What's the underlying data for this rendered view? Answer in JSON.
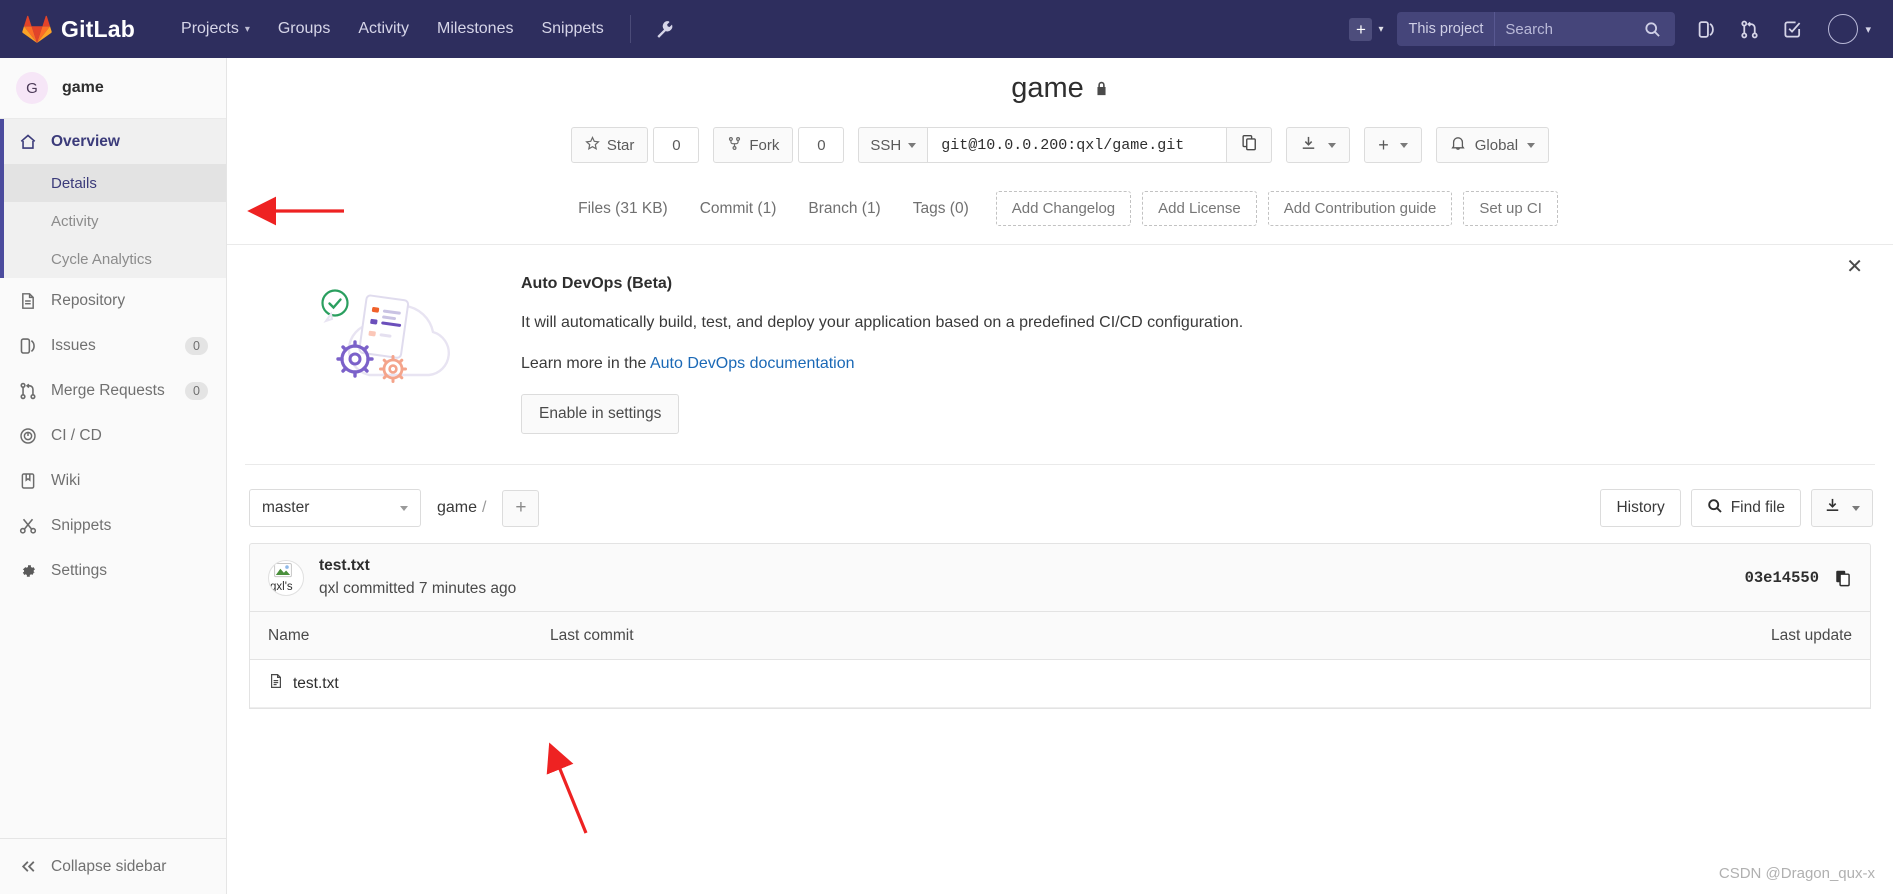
{
  "navbar": {
    "brand": "GitLab",
    "links": [
      {
        "label": "Projects",
        "has_caret": true
      },
      {
        "label": "Groups",
        "has_caret": false
      },
      {
        "label": "Activity",
        "has_caret": false
      },
      {
        "label": "Milestones",
        "has_caret": false
      },
      {
        "label": "Snippets",
        "has_caret": false
      }
    ],
    "wrench_icon": "wrench-icon",
    "plus_icon": "plus-icon",
    "search": {
      "scope": "This project",
      "value": "",
      "placeholder": "Search"
    },
    "icons": [
      {
        "name": "issues-icon"
      },
      {
        "name": "merge-requests-icon"
      },
      {
        "name": "todos-icon"
      }
    ],
    "avatar_icon": "user-avatar-icon"
  },
  "sidebar": {
    "project_initial": "G",
    "project_name": "game",
    "overview": {
      "label": "Overview",
      "icon": "home-icon",
      "subitems": [
        {
          "label": "Details",
          "selected": true
        },
        {
          "label": "Activity",
          "selected": false
        },
        {
          "label": "Cycle Analytics",
          "selected": false
        }
      ]
    },
    "items": [
      {
        "label": "Repository",
        "icon": "document-icon",
        "badge": ""
      },
      {
        "label": "Issues",
        "icon": "issues-icon",
        "badge": "0"
      },
      {
        "label": "Merge Requests",
        "icon": "merge-requests-icon",
        "badge": "0"
      },
      {
        "label": "CI / CD",
        "icon": "rocket-icon",
        "badge": ""
      },
      {
        "label": "Wiki",
        "icon": "book-icon",
        "badge": ""
      },
      {
        "label": "Snippets",
        "icon": "scissors-icon",
        "badge": ""
      },
      {
        "label": "Settings",
        "icon": "gear-icon",
        "badge": ""
      }
    ],
    "collapse": {
      "label": "Collapse sidebar",
      "icon": "double-chevron-left-icon"
    }
  },
  "project": {
    "title": "game",
    "visibility_icon": "lock-icon",
    "star": {
      "label": "Star",
      "count": "0",
      "icon": "star-icon"
    },
    "fork": {
      "label": "Fork",
      "count": "0",
      "icon": "fork-icon"
    },
    "clone": {
      "protocol": "SSH",
      "url": "git@10.0.0.200:qxl/game.git",
      "copy_icon": "copy-icon"
    },
    "download_icon": "download-icon",
    "add_icon": "plus-icon",
    "notification": {
      "label": "Global",
      "icon": "bell-icon"
    }
  },
  "stats": {
    "links": [
      {
        "label": "Files (31 KB)"
      },
      {
        "label": "Commit (1)"
      },
      {
        "label": "Branch (1)"
      },
      {
        "label": "Tags (0)"
      }
    ],
    "actions": [
      {
        "label": "Add Changelog"
      },
      {
        "label": "Add License"
      },
      {
        "label": "Add Contribution guide"
      },
      {
        "label": "Set up CI"
      }
    ]
  },
  "auto_devops": {
    "title": "Auto DevOps (Beta)",
    "description": "It will automatically build, test, and deploy your application based on a predefined CI/CD configuration.",
    "learn_prefix": "Learn more in the ",
    "learn_link": "Auto DevOps documentation",
    "enable_label": "Enable in settings",
    "close_icon": "close-icon"
  },
  "tree": {
    "branch": "master",
    "breadcrumb_root": "game",
    "breadcrumb_sep": "/",
    "add_icon": "plus-icon",
    "history_label": "History",
    "find_file_label": "Find file",
    "find_file_icon": "search-icon",
    "download_icon": "download-icon"
  },
  "last_commit": {
    "avatar_alt": "qxl's",
    "title": "test.txt",
    "meta": "qxl committed 7 minutes ago",
    "sha": "03e14550",
    "copy_icon": "copy-icon"
  },
  "file_table": {
    "columns": [
      "Name",
      "Last commit",
      "Last update"
    ],
    "rows": [
      {
        "name": "test.txt",
        "icon": "file-icon",
        "last_commit": "",
        "last_update": ""
      }
    ]
  },
  "watermark": "CSDN @Dragon_qux-x",
  "colors": {
    "navbar": "#2e2e5e",
    "accent": "#4b4b9d",
    "link": "#1b69b6",
    "annotation": "#ee2222"
  }
}
